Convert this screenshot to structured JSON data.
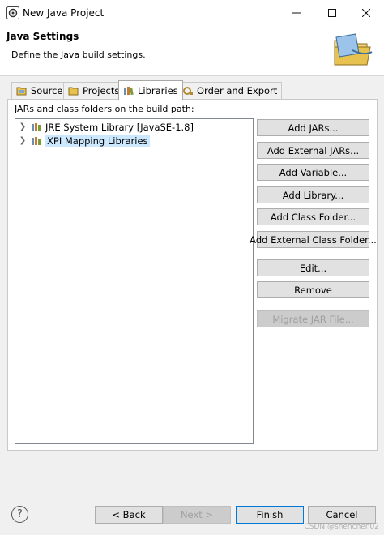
{
  "window": {
    "title": "New Java Project"
  },
  "header": {
    "title": "Java Settings",
    "description": "Define the Java build settings."
  },
  "tabs": [
    {
      "label": "Source",
      "icon": "source-folder-icon"
    },
    {
      "label": "Projects",
      "icon": "projects-folder-icon"
    },
    {
      "label": "Libraries",
      "icon": "libraries-icon",
      "active": true
    },
    {
      "label": "Order and Export",
      "icon": "order-export-icon"
    }
  ],
  "build_path": {
    "label": "JARs and class folders on the build path:",
    "items": [
      {
        "label": "JRE System Library [JavaSE-1.8]",
        "selected": false
      },
      {
        "label": "XPI Mapping Libraries",
        "selected": true
      }
    ]
  },
  "actions": {
    "add_jars": "Add JARs...",
    "add_external_jars": "Add External JARs...",
    "add_variable": "Add Variable...",
    "add_library": "Add Library...",
    "add_class_folder": "Add Class Folder...",
    "add_external_class_folder": "Add External Class Folder...",
    "edit": "Edit...",
    "remove": "Remove",
    "migrate_jar": "Migrate JAR File..."
  },
  "footer": {
    "help": "?",
    "back": "< Back",
    "next": "Next >",
    "finish": "Finish",
    "cancel": "Cancel"
  },
  "watermark": "CSDN @shenchen02",
  "colors": {
    "accent": "#0078d7",
    "selection": "#cce8ff"
  }
}
